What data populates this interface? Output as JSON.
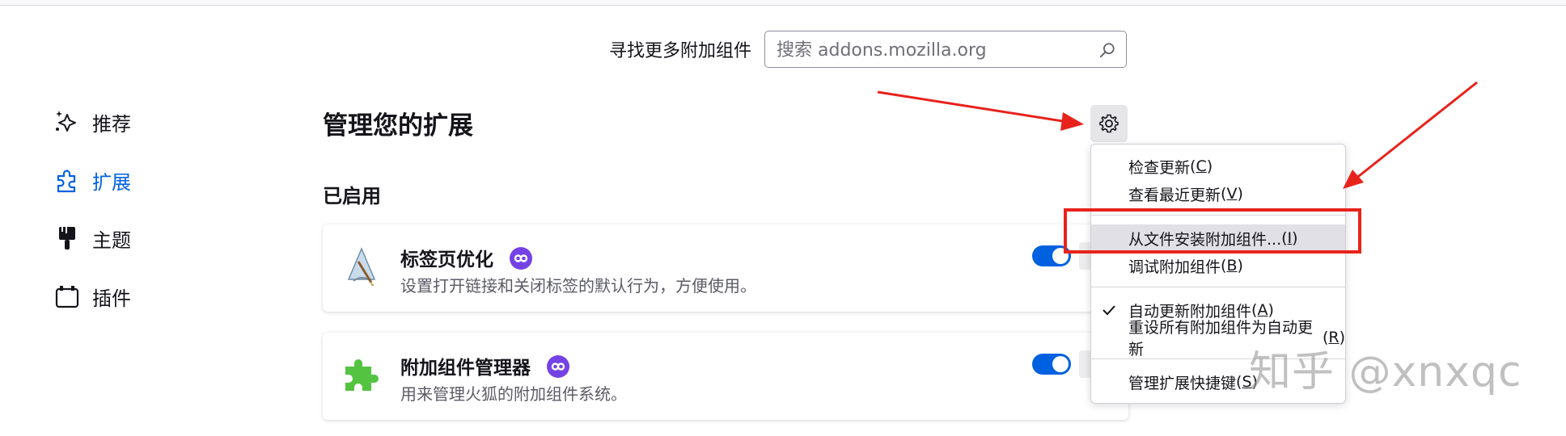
{
  "header": {
    "find_label": "寻找更多附加组件",
    "search_placeholder": "搜索 addons.mozilla.org"
  },
  "sidebar": {
    "items": [
      {
        "label": "推荐",
        "icon": "sparkle-icon"
      },
      {
        "label": "扩展",
        "icon": "puzzle-icon",
        "active": true
      },
      {
        "label": "主题",
        "icon": "paintbrush-icon"
      },
      {
        "label": "插件",
        "icon": "plugin-icon"
      }
    ]
  },
  "main": {
    "title": "管理您的扩展",
    "section_enabled": "已启用",
    "extensions": [
      {
        "name": "标签页优化",
        "description": "设置打开链接和关闭标签的默认行为，方便使用。",
        "enabled": true
      },
      {
        "name": "附加组件管理器",
        "description": "用来管理火狐的附加组件系统。",
        "enabled": true
      }
    ]
  },
  "menu": {
    "items": [
      {
        "label": "检查更新",
        "key": "C"
      },
      {
        "label": "查看最近更新",
        "key": "V"
      },
      {
        "label": "从文件安装附加组件...",
        "key": "I",
        "highlighted": true
      },
      {
        "label": "调试附加组件",
        "key": "B"
      },
      {
        "label": "自动更新附加组件",
        "key": "A",
        "checked": true
      },
      {
        "label": "重设所有附加组件为自动更新",
        "key": "R"
      },
      {
        "label": "管理扩展快捷键",
        "key": "S"
      }
    ]
  },
  "colors": {
    "accent": "#0061e0",
    "annotation_red": "#e8231c",
    "badge_purple": "#7542e5"
  },
  "watermark": "知乎 @xnxqc"
}
